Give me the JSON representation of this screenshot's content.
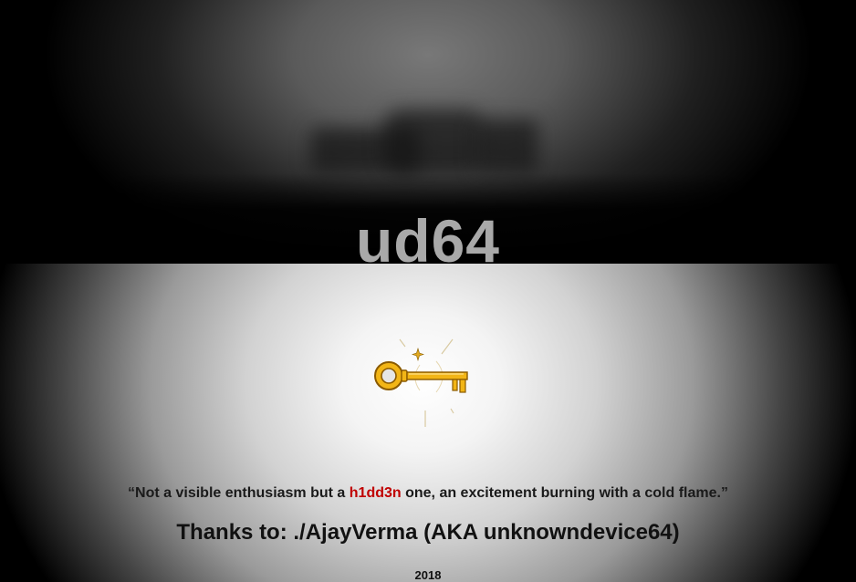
{
  "header": {
    "brand": "ud64"
  },
  "hero": {
    "icon": "golden-key-icon",
    "accent_color": "#f2b516"
  },
  "quote": {
    "open_mark": "“",
    "before": "Not a visible enthusiasm but a ",
    "highlight": "h1dd3n",
    "after": " one, an excitement burning with a cold flame.",
    "close_mark": "”",
    "highlight_color": "#c00000"
  },
  "credits": {
    "thanks": "Thanks to: ./AjayVerma (AKA unknowndevice64)"
  },
  "footer": {
    "year": "2018"
  }
}
